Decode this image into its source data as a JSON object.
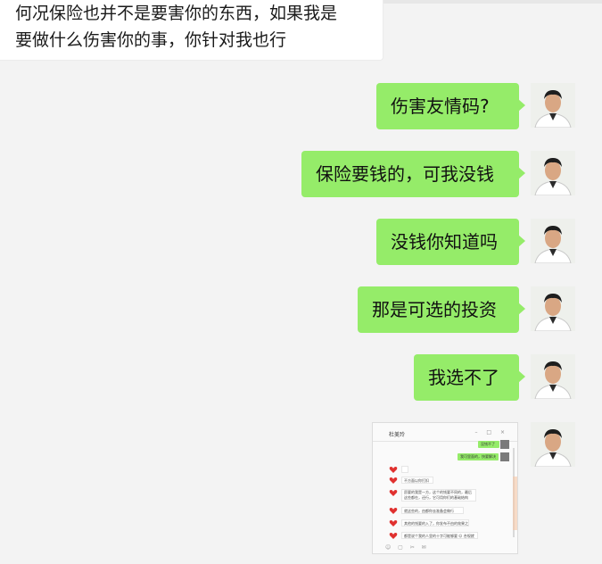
{
  "incoming_message": {
    "text": "何况保险也并不是要害你的东西，如果我是\n要做什么伤害你的事，你针对我也行"
  },
  "outgoing_messages": [
    {
      "text": "伤害友情码?"
    },
    {
      "text": "保险要钱的，可我没钱"
    },
    {
      "text": "没钱你知道吗"
    },
    {
      "text": "那是可选的投资"
    },
    {
      "text": "我选不了"
    }
  ],
  "image_message": {
    "title": "杜美玲",
    "window_controls": "– □ ×",
    "green_lines": [
      "没钱不了",
      "我可里面的，快要解决"
    ],
    "left_lines": [
      "不方面以你打扣",
      "愿要的我是一方，这个的钱要不同的，最后这些都在，还行，它可用你们的基础结构",
      "就这些的，由都你去准备会做行",
      "其他的钱要的入了，你发布不由的效果之",
      "都是说个我的人里的十字可能够要 ☺ 合规就"
    ],
    "footer_icons": "☺ ▢ ✂ ✉"
  },
  "colors": {
    "background": "#f3f3f3",
    "outgoing_bubble": "#95ec69",
    "incoming_bubble": "#ffffff"
  }
}
